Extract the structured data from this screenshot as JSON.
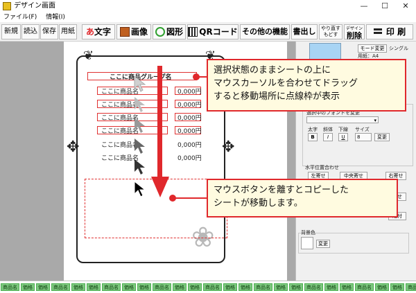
{
  "window": {
    "title": "デザイン画面",
    "controls": [
      "—",
      "☐",
      "✕"
    ]
  },
  "menu": [
    "ファイル(F)",
    "情報(I)"
  ],
  "toolbar": {
    "new": "新規",
    "load": "読込",
    "save": "保存",
    "paper": "用紙",
    "text": "文字",
    "text_icon": "あ",
    "image": "画像",
    "shape": "図形",
    "qr": "QRコード",
    "other": "その他の機能",
    "bulk": "書出し",
    "undo": "やり直す",
    "redo": "もどす",
    "design_small": "デザイン",
    "del": "削除",
    "print": "印 刷"
  },
  "paper": {
    "title": "ここに商品グループ名",
    "rows": [
      {
        "name": "ここに商品名",
        "price": "0,000円"
      },
      {
        "name": "ここに商品名",
        "price": "0,000円"
      },
      {
        "name": "ここに商品名",
        "price": "0,000円"
      },
      {
        "name": "ここに商品名",
        "price": "0,000円"
      },
      {
        "name": "ここに商品名",
        "price": "0,000円"
      },
      {
        "name": "ここに商品名",
        "price": "0,000円"
      }
    ]
  },
  "panel": {
    "mode_button": "モード変更",
    "mode_value": "シングル",
    "paper_size": "用紙：A4",
    "select_color": "選択中の色を変更",
    "select_font": "選択中のフォントを変更",
    "style_labels": [
      "太字",
      "斜体",
      "下線",
      "サイズ"
    ],
    "bold": "B",
    "italic": "I",
    "underline": "U",
    "size_value": "8",
    "size_change": "変更",
    "halign_title": "水平位置合わせ",
    "left": "左寄せ",
    "center": "中央寄せ",
    "right": "右寄せ",
    "partial": "寄せ",
    "paste": "貼付",
    "bg_title": "背景色",
    "bg_change": "変更"
  },
  "callouts": {
    "top": "選択状態のままシートの上に\nマウスカーソルを合わせてドラッグ\nすると移動場所に点線枠が表示",
    "bottom": "マウスボタンを離すとコピーした\nシートが移動します。"
  },
  "status_chips": [
    "商品名",
    "価格",
    "価格",
    "商品名",
    "価格",
    "価格",
    "商品名",
    "価格",
    "価格",
    "商品名",
    "価格",
    "価格",
    "商品名",
    "価格",
    "価格",
    "商品名",
    "価格",
    "価格",
    "商品名",
    "価格",
    "価格",
    "商品名",
    "価格",
    "価格",
    "商品名",
    "価格"
  ],
  "colors": {
    "accent_red": "#e0282c",
    "callout_bg": "#fffbe0",
    "preview": "#a8d4f4",
    "status_chip": "#7dc87f"
  }
}
